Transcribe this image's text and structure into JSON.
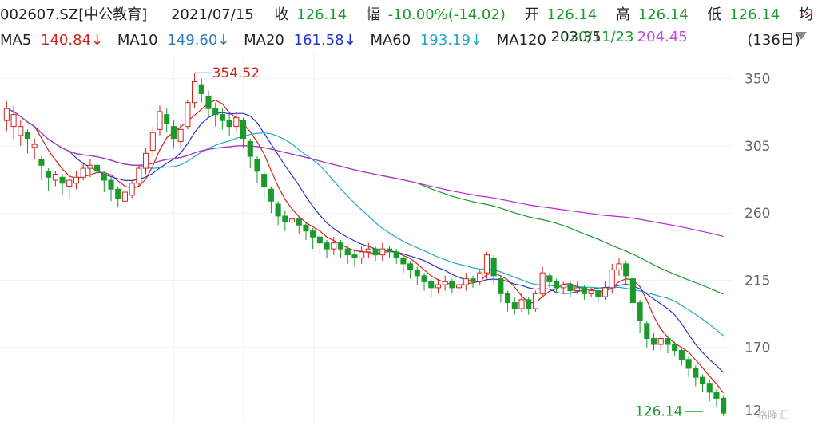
{
  "header": {
    "code": "002607.SZ[中公教育]",
    "date": "2021/07/15",
    "close_label": "收",
    "close": "126.14",
    "change_label": "幅",
    "change": "-10.00%(-14.02)",
    "open_label": "开",
    "open": "126.14",
    "high_label": "高",
    "high": "126.14",
    "low_label": "低",
    "low": "126.14",
    "avg_label": "均",
    "more": "..."
  },
  "ma_bar": {
    "ma5_label": "MA5",
    "ma5": "140.84↓",
    "ma10_label": "MA10",
    "ma10": "149.60↓",
    "ma20_label": "MA20",
    "ma20": "161.58↓",
    "ma60_label": "MA60",
    "ma60": "193.19↓",
    "ma120_label": "MA120",
    "ma120_overlap": "2020/11/23",
    "ma120_overlap2": "203.35",
    "ma250_value": "204.45",
    "period": "(136日)"
  },
  "colors": {
    "up": "#d0241c",
    "down": "#1a9a2a",
    "ma5": "#d0241c",
    "ma10": "#2336c9",
    "ma20": "#1fa9c4",
    "ma60": "#1a9a2a",
    "ma120": "#b52bd3"
  },
  "chart_data": {
    "type": "candlestick",
    "y_ticks": [
      "350",
      "305",
      "260",
      "215",
      "170",
      "12"
    ],
    "ylim": [
      125,
      360
    ],
    "high_label": "354.52",
    "last_label": "126.14",
    "candles": [
      [
        322,
        330,
        315,
        335
      ],
      [
        318,
        326,
        310,
        332
      ],
      [
        312,
        318,
        305,
        322
      ],
      [
        314,
        310,
        300,
        316
      ],
      [
        304,
        306,
        296,
        310
      ],
      [
        296,
        292,
        282,
        298
      ],
      [
        288,
        284,
        275,
        290
      ],
      [
        282,
        286,
        278,
        288
      ],
      [
        284,
        280,
        272,
        286
      ],
      [
        278,
        282,
        270,
        284
      ],
      [
        280,
        284,
        276,
        288
      ],
      [
        284,
        290,
        282,
        294
      ],
      [
        290,
        292,
        284,
        296
      ],
      [
        292,
        288,
        282,
        294
      ],
      [
        286,
        282,
        274,
        288
      ],
      [
        282,
        276,
        268,
        284
      ],
      [
        276,
        270,
        264,
        278
      ],
      [
        268,
        274,
        262,
        276
      ],
      [
        272,
        280,
        270,
        282
      ],
      [
        280,
        290,
        278,
        292
      ],
      [
        290,
        300,
        286,
        304
      ],
      [
        302,
        314,
        298,
        318
      ],
      [
        316,
        328,
        312,
        332
      ],
      [
        326,
        320,
        314,
        330
      ],
      [
        318,
        310,
        304,
        322
      ],
      [
        308,
        316,
        304,
        320
      ],
      [
        318,
        334,
        316,
        336
      ],
      [
        334,
        348,
        330,
        354
      ],
      [
        346,
        340,
        334,
        350
      ],
      [
        338,
        330,
        324,
        342
      ],
      [
        330,
        326,
        318,
        334
      ],
      [
        326,
        322,
        316,
        330
      ],
      [
        322,
        318,
        312,
        326
      ],
      [
        318,
        324,
        314,
        328
      ],
      [
        322,
        310,
        304,
        324
      ],
      [
        308,
        298,
        290,
        310
      ],
      [
        296,
        288,
        280,
        298
      ],
      [
        286,
        278,
        270,
        288
      ],
      [
        276,
        268,
        260,
        278
      ],
      [
        266,
        258,
        252,
        268
      ],
      [
        258,
        254,
        248,
        262
      ],
      [
        254,
        256,
        250,
        260
      ],
      [
        256,
        252,
        246,
        258
      ],
      [
        252,
        248,
        242,
        254
      ],
      [
        248,
        244,
        236,
        250
      ],
      [
        244,
        240,
        232,
        246
      ],
      [
        240,
        236,
        230,
        242
      ],
      [
        236,
        240,
        232,
        244
      ],
      [
        240,
        236,
        230,
        242
      ],
      [
        236,
        232,
        226,
        238
      ],
      [
        232,
        230,
        224,
        236
      ],
      [
        230,
        234,
        226,
        238
      ],
      [
        234,
        236,
        230,
        240
      ],
      [
        236,
        232,
        228,
        238
      ],
      [
        232,
        236,
        228,
        240
      ],
      [
        236,
        234,
        230,
        238
      ],
      [
        234,
        230,
        226,
        236
      ],
      [
        230,
        226,
        220,
        232
      ],
      [
        226,
        222,
        216,
        228
      ],
      [
        222,
        218,
        212,
        224
      ],
      [
        218,
        214,
        208,
        220
      ],
      [
        214,
        210,
        204,
        216
      ],
      [
        210,
        212,
        206,
        216
      ],
      [
        212,
        214,
        208,
        218
      ],
      [
        214,
        210,
        206,
        216
      ],
      [
        210,
        212,
        206,
        214
      ],
      [
        212,
        216,
        208,
        220
      ],
      [
        216,
        214,
        210,
        218
      ],
      [
        214,
        220,
        212,
        222
      ],
      [
        220,
        232,
        216,
        234
      ],
      [
        230,
        218,
        212,
        232
      ],
      [
        216,
        206,
        200,
        218
      ],
      [
        206,
        200,
        194,
        208
      ],
      [
        200,
        196,
        192,
        204
      ],
      [
        196,
        202,
        194,
        206
      ],
      [
        202,
        196,
        192,
        204
      ],
      [
        196,
        206,
        194,
        208
      ],
      [
        206,
        220,
        204,
        224
      ],
      [
        218,
        214,
        210,
        220
      ],
      [
        214,
        210,
        206,
        216
      ],
      [
        210,
        212,
        206,
        214
      ],
      [
        212,
        208,
        204,
        214
      ],
      [
        208,
        210,
        206,
        214
      ],
      [
        210,
        206,
        202,
        212
      ],
      [
        206,
        208,
        204,
        210
      ],
      [
        208,
        204,
        200,
        210
      ],
      [
        204,
        210,
        202,
        214
      ],
      [
        210,
        222,
        206,
        226
      ],
      [
        222,
        226,
        218,
        230
      ],
      [
        226,
        218,
        212,
        228
      ],
      [
        216,
        200,
        192,
        218
      ],
      [
        200,
        188,
        180,
        202
      ],
      [
        186,
        176,
        170,
        188
      ],
      [
        176,
        172,
        168,
        180
      ],
      [
        172,
        176,
        168,
        178
      ],
      [
        176,
        172,
        166,
        178
      ],
      [
        172,
        168,
        164,
        174
      ],
      [
        168,
        162,
        158,
        170
      ],
      [
        162,
        156,
        150,
        164
      ],
      [
        156,
        150,
        144,
        158
      ],
      [
        150,
        146,
        140,
        152
      ],
      [
        146,
        140,
        134,
        148
      ],
      [
        140,
        136,
        130,
        142
      ],
      [
        136,
        126,
        124,
        138
      ]
    ]
  }
}
